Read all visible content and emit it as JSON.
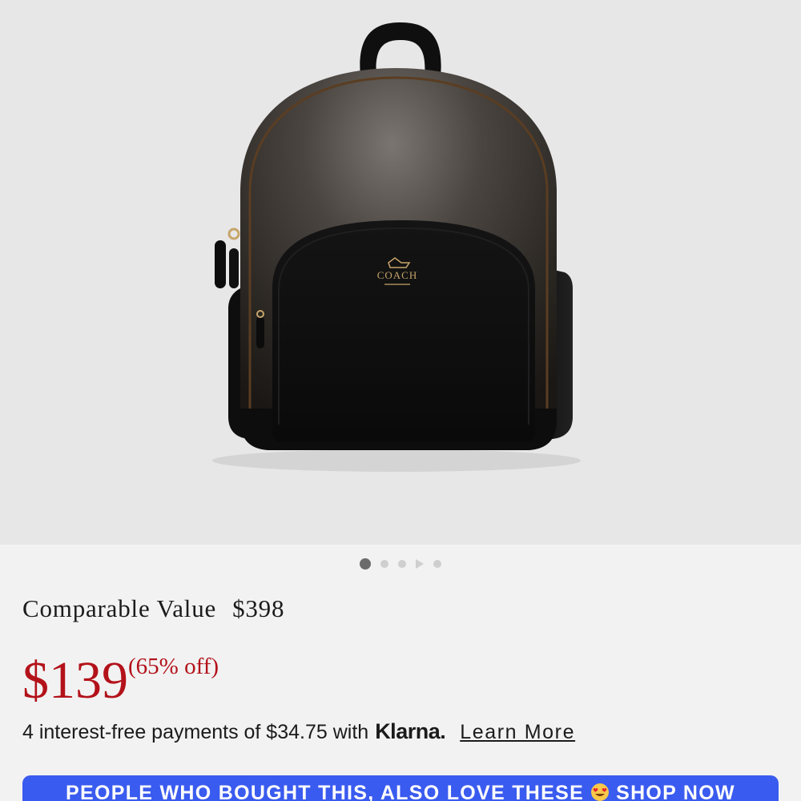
{
  "product": {
    "image_alt": "black COACH backpack",
    "logo_text": "COACH",
    "gallery": {
      "total_items": 5,
      "active_index": 0,
      "video_index": 3
    }
  },
  "pricing": {
    "comparable_label": "Comparable Value",
    "comparable_value": "$398",
    "price": "$139",
    "discount": "(65% off)"
  },
  "financing": {
    "text": "4 interest-free payments of $34.75 with",
    "provider": "Klarna.",
    "learn_more": "Learn More"
  },
  "banner": {
    "text_before": "PEOPLE WHO BOUGHT THIS, ALSO LOVE THESE",
    "emoji": "heart-eyes-emoji",
    "cta": "SHOP NOW",
    "color": "#3a5bef"
  },
  "colors": {
    "price_red": "#b3121a",
    "hero_bg": "#e7e7e8",
    "page_bg": "#f2f2f2"
  }
}
